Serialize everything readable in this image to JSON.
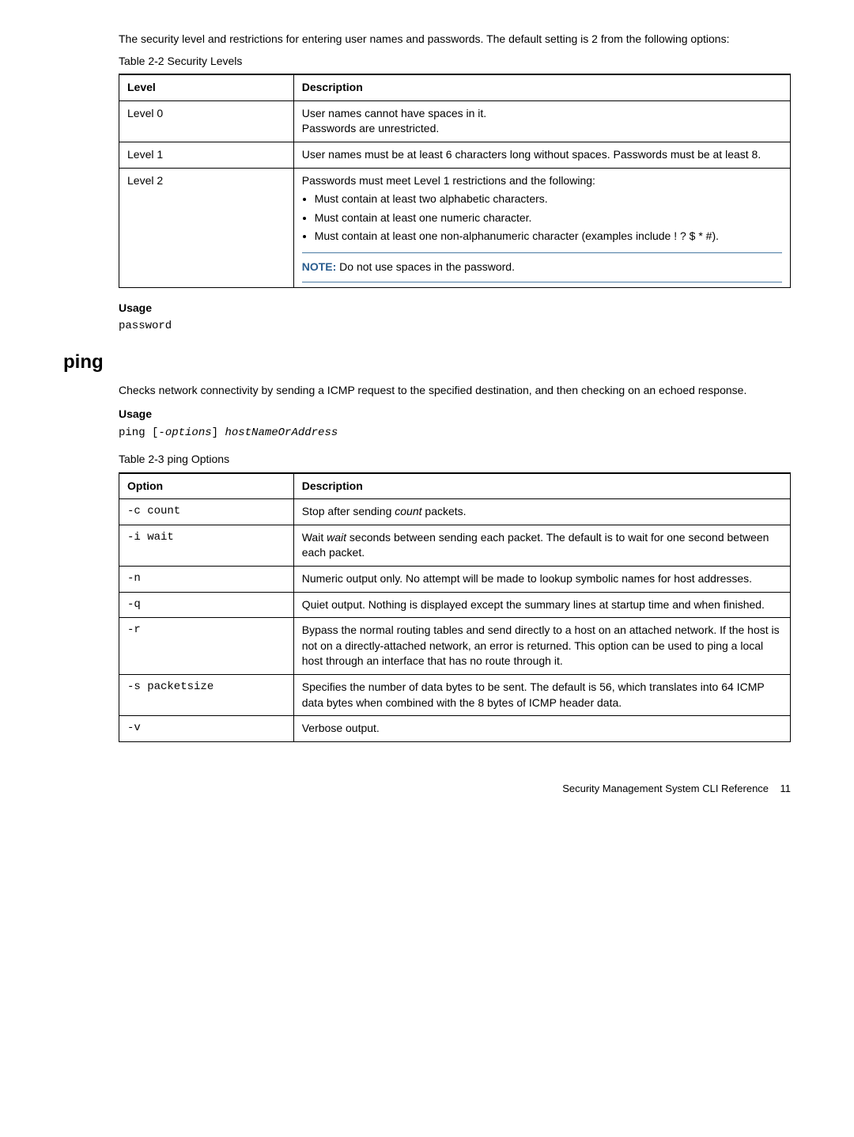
{
  "intro": "The security level and restrictions for entering user names and passwords. The default setting is 2 from the following options:",
  "table1": {
    "caption": "Table 2-2   Security Levels",
    "header": {
      "col1": "Level",
      "col2": "Description"
    },
    "row0": {
      "level": "Level 0",
      "line1": "User names cannot have spaces in it.",
      "line2": "Passwords are unrestricted."
    },
    "row1": {
      "level": "Level 1",
      "line1": "User names must be at least 6 characters long without spaces. Passwords must be at least 8."
    },
    "row2": {
      "level": "Level 2",
      "intro": "Passwords must meet Level 1 restrictions and the following:",
      "b1": "Must contain at least two alphabetic characters.",
      "b2": "Must contain at least one numeric character.",
      "b3": "Must contain at least one non-alphanumeric character (examples include ! ? $ * #).",
      "note_label": "NOTE:",
      "note_text": "   Do not use spaces in the password."
    }
  },
  "usage1": {
    "heading": "Usage",
    "code": "password"
  },
  "ping": {
    "heading": "ping",
    "desc": "Checks network connectivity by sending a ICMP request to the specified destination, and then checking on an echoed response.",
    "usage_heading": "Usage",
    "code_prefix": "ping [-",
    "code_options": "options",
    "code_mid": "] ",
    "code_host": "hostNameOrAddress"
  },
  "table2": {
    "caption": "Table 2-3   ping Options",
    "header": {
      "col1": "Option",
      "col2": "Description"
    },
    "r0": {
      "opt": "-c count",
      "d_pre": "Stop after sending ",
      "d_em": "count",
      "d_post": " packets."
    },
    "r1": {
      "opt": "-i wait",
      "d_pre": "Wait ",
      "d_em": "wait",
      "d_post": " seconds between sending each packet. The default is to wait for one second between each packet."
    },
    "r2": {
      "opt": "-n",
      "d": "Numeric output only. No attempt will be made to lookup symbolic names for host addresses."
    },
    "r3": {
      "opt": "-q",
      "d": "Quiet output. Nothing is displayed except the summary lines at startup time and when finished."
    },
    "r4": {
      "opt": "-r",
      "d": "Bypass the normal routing tables and send directly to a host on an attached network. If the host is not on a directly-attached network, an error is returned. This option can be used to ping a local host through an interface that has no route through it."
    },
    "r5": {
      "opt": "-s packetsize",
      "d": "Specifies the number of data bytes to be sent. The default is 56, which translates into 64 ICMP data bytes when combined with the 8 bytes of ICMP header data."
    },
    "r6": {
      "opt": "-v",
      "d": "Verbose output."
    }
  },
  "footer": {
    "text": "Security Management System CLI Reference",
    "page": "11"
  }
}
